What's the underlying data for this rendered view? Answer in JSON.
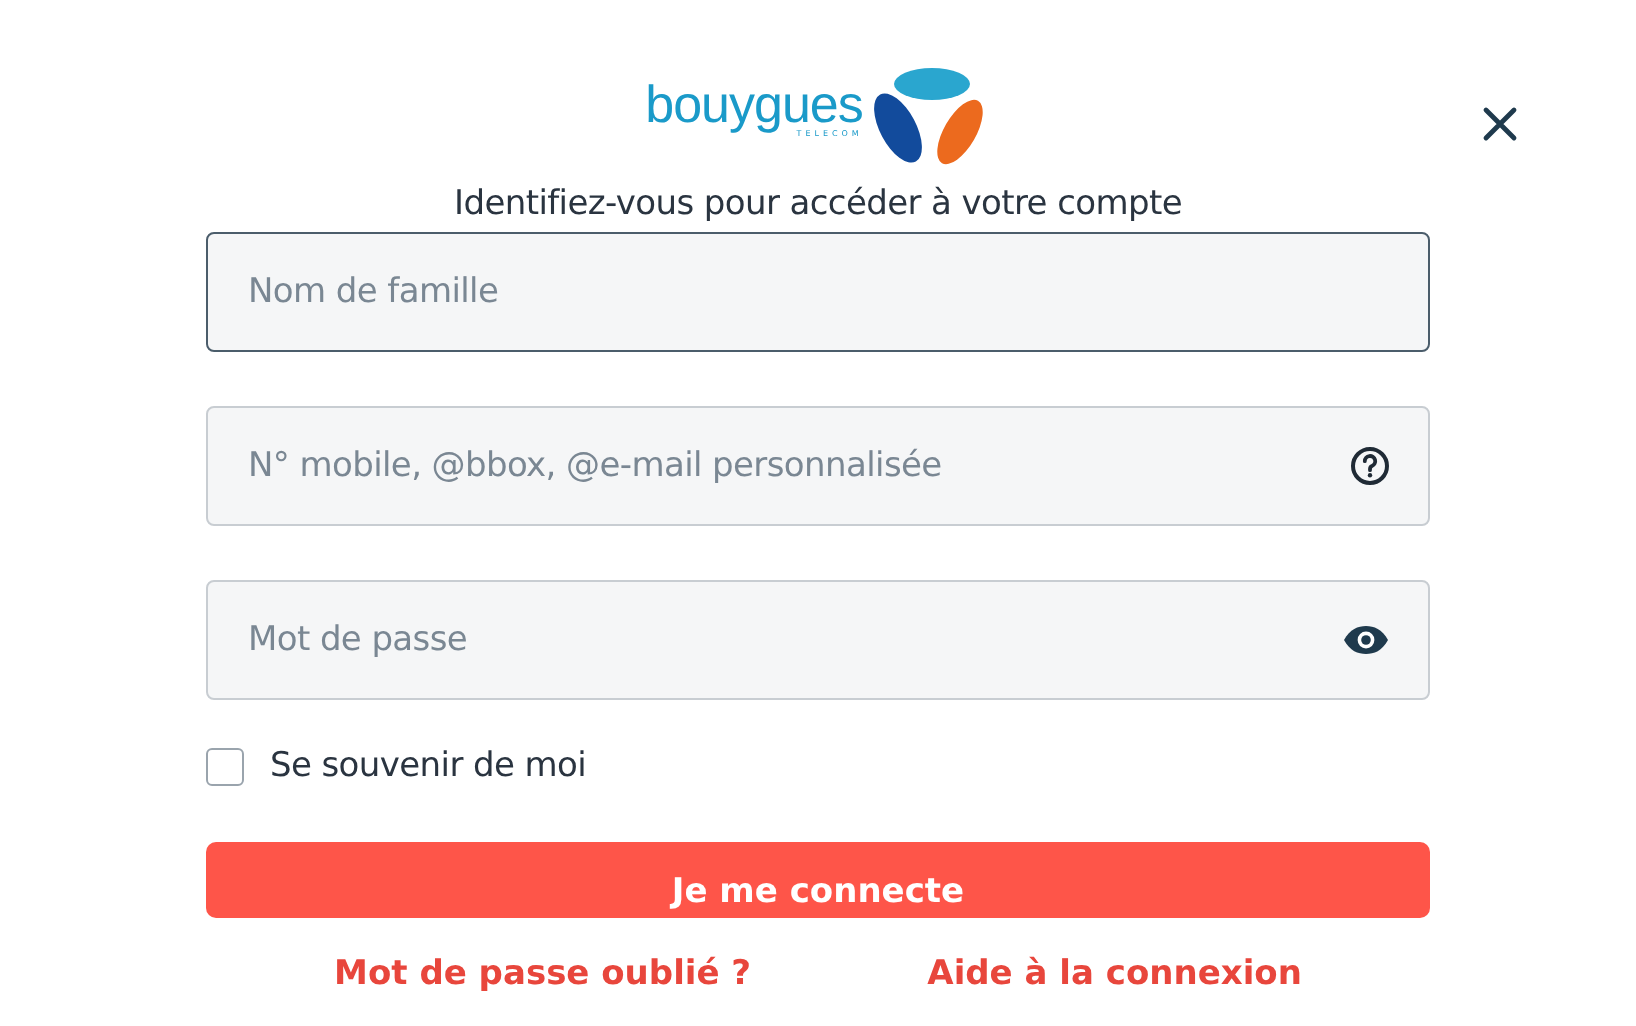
{
  "logo": {
    "wordmark": "bouygues",
    "subtitle": "TELECOM"
  },
  "heading": "Identifiez-vous pour accéder à votre compte",
  "fields": [
    {
      "kind": "plain",
      "placeholder": "Nom de famille",
      "focused": true
    },
    {
      "kind": "help",
      "placeholder": "N° mobile, @bbox, @e-mail personnalisée",
      "focused": false
    },
    {
      "kind": "password",
      "placeholder": "Mot de passe",
      "focused": false
    }
  ],
  "remember": {
    "label": "Se souvenir de moi",
    "checked": false
  },
  "submit": "Je me connecte",
  "links": [
    "Mot de passe oublié ?",
    "Aide à la connexion"
  ]
}
